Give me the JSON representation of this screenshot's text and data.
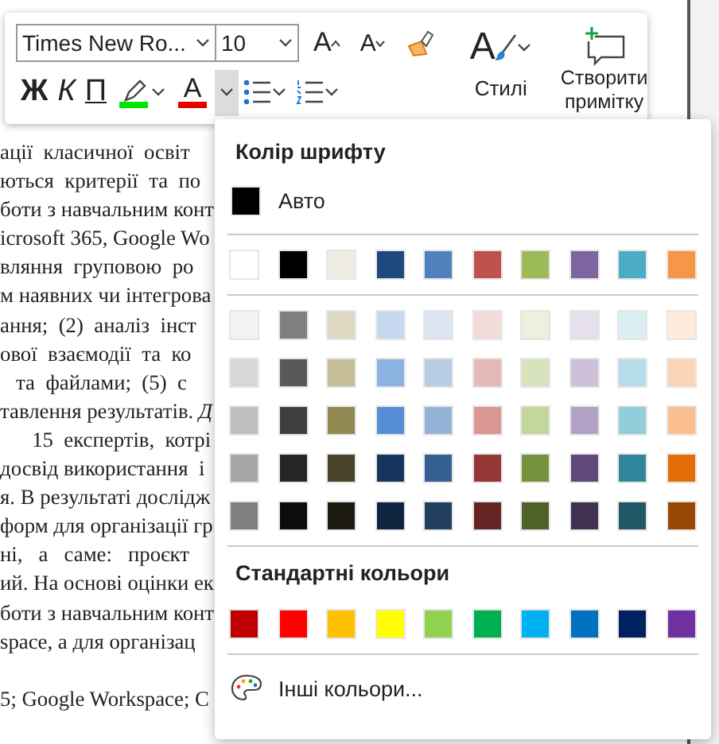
{
  "document": {
    "paragraphs": [
      {
        "lines": [
          "ації  класичної  освіт",
          "ються  критерії  та  по",
          "боти з навчальним конт",
          "icrosoft 365, Google Wo",
          "вляння  груповою  ро",
          "м наявних чи інтегрова",
          "ання;  (2)  аналіз  інст",
          "ової  взаємодії  та  ко",
          "   та  файлами;  (5)  с",
          "тавлення результатів. *Д*",
          "      15  експертів,  котрі",
          "досвід використання  і",
          "я. В результаті дослідж",
          "форм для організації гр",
          "ні,   а   саме:   проєкт",
          "ий. На основі оцінки ек",
          "боти з навчальним конт",
          "space, а для організац"
        ]
      },
      {
        "lines": [
          "5; Google Workspace; С"
        ]
      }
    ]
  },
  "toolbar": {
    "font_name": "Times New Ro...",
    "font_size": "10",
    "grow_font": "A",
    "shrink_font": "A",
    "bold": "Ж",
    "italic": "К",
    "underline": "П",
    "highlight": {
      "color": "#00e600"
    },
    "font_color": {
      "label": "A",
      "color": "#e60000",
      "menu_open": true
    },
    "styles_icon": "A",
    "styles": "Стилі",
    "new_comment": "Створити примітку"
  },
  "color_menu": {
    "title": "Колір шрифту",
    "auto": {
      "label": "Авто",
      "color": "#000000"
    },
    "theme_colors": [
      {
        "color": "#ffffff"
      },
      {
        "color": "#000000"
      },
      {
        "color": "#eeece1"
      },
      {
        "color": "#1f497d"
      },
      {
        "color": "#4f81bd"
      },
      {
        "color": "#c0504d"
      },
      {
        "color": "#9bbb59"
      },
      {
        "color": "#8064a2"
      },
      {
        "color": "#4bacc6"
      },
      {
        "color": "#f79646"
      }
    ],
    "shade_rows": [
      {
        "swatches": [
          {
            "color": "#f2f2f2"
          },
          {
            "color": "#7f7f7f"
          },
          {
            "color": "#ddd9c3"
          },
          {
            "color": "#c6d9f0"
          },
          {
            "color": "#dbe5f1"
          },
          {
            "color": "#f2dcdb"
          },
          {
            "color": "#ebf1dd"
          },
          {
            "color": "#e5e0ec"
          },
          {
            "color": "#dbeef3"
          },
          {
            "color": "#fdeada"
          }
        ]
      },
      {
        "swatches": [
          {
            "color": "#d8d8d8"
          },
          {
            "color": "#595959"
          },
          {
            "color": "#c4bd97"
          },
          {
            "color": "#8db3e2"
          },
          {
            "color": "#b8cce4"
          },
          {
            "color": "#e5b9b7"
          },
          {
            "color": "#d7e3bc"
          },
          {
            "color": "#ccc1d9"
          },
          {
            "color": "#b7dde8"
          },
          {
            "color": "#fbd5b5"
          }
        ]
      },
      {
        "swatches": [
          {
            "color": "#bfbfbf"
          },
          {
            "color": "#3f3f3f"
          },
          {
            "color": "#938953"
          },
          {
            "color": "#548dd4"
          },
          {
            "color": "#95b3d7"
          },
          {
            "color": "#d99694"
          },
          {
            "color": "#c3d69b"
          },
          {
            "color": "#b2a2c7"
          },
          {
            "color": "#92cddc"
          },
          {
            "color": "#fac08f"
          }
        ]
      },
      {
        "swatches": [
          {
            "color": "#a5a5a5"
          },
          {
            "color": "#262626"
          },
          {
            "color": "#494429"
          },
          {
            "color": "#17365d"
          },
          {
            "color": "#366092"
          },
          {
            "color": "#953734"
          },
          {
            "color": "#76923c"
          },
          {
            "color": "#5f497a"
          },
          {
            "color": "#31859b"
          },
          {
            "color": "#e36c09"
          }
        ]
      },
      {
        "swatches": [
          {
            "color": "#7f7f7f"
          },
          {
            "color": "#0c0c0c"
          },
          {
            "color": "#1d1b10"
          },
          {
            "color": "#0f243e"
          },
          {
            "color": "#244061"
          },
          {
            "color": "#632423"
          },
          {
            "color": "#4f6128"
          },
          {
            "color": "#3f3151"
          },
          {
            "color": "#205867"
          },
          {
            "color": "#974806"
          }
        ]
      }
    ],
    "standard_title": "Стандартні кольори",
    "standard_colors": [
      {
        "color": "#c00000"
      },
      {
        "color": "#ff0000"
      },
      {
        "color": "#ffc000"
      },
      {
        "color": "#ffff00"
      },
      {
        "color": "#92d050"
      },
      {
        "color": "#00b050"
      },
      {
        "color": "#00b0f0"
      },
      {
        "color": "#0070c0"
      },
      {
        "color": "#002060"
      },
      {
        "color": "#7030a0"
      }
    ],
    "more_colors": "Інші кольори..."
  }
}
